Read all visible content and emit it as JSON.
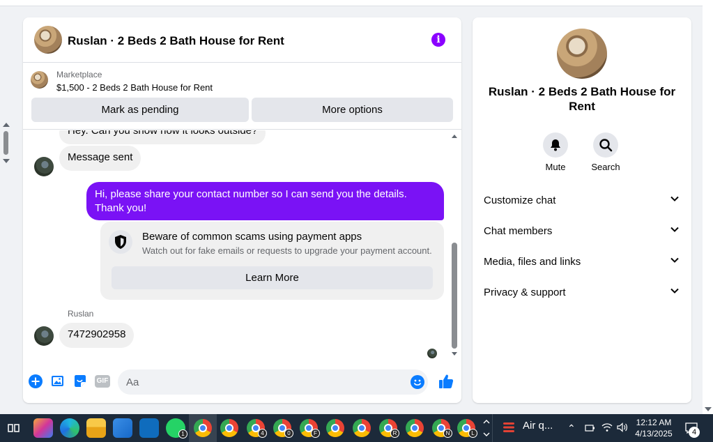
{
  "chat": {
    "title": "Ruslan · 2 Beds 2 Bath House for Rent",
    "marketplace": {
      "label": "Marketplace",
      "listing": "$1,500 - 2 Beds 2 Bath House for Rent",
      "mark_pending_label": "Mark as pending",
      "more_options_label": "More options"
    },
    "messages": {
      "partial_message": "Hey. Can you show how it looks outside?",
      "message_sent": "Message sent",
      "outgoing": "Hi, please share your contact number so I can send you the details. Thank you!",
      "scam_warning": {
        "title": "Beware of common scams using payment apps",
        "subtitle": "Watch out for fake emails or requests to upgrade your payment account.",
        "button": "Learn More"
      },
      "sender_name": "Ruslan",
      "phone_message": "7472902958"
    },
    "composer": {
      "placeholder": "Aa",
      "gif_label": "GIF"
    },
    "accent_color": "#7a12f5"
  },
  "side_panel": {
    "title": "Ruslan · 2 Beds 2 Bath House for Rent",
    "actions": [
      {
        "label": "Mute",
        "icon": "bell-icon"
      },
      {
        "label": "Search",
        "icon": "search-icon"
      }
    ],
    "sections": [
      {
        "label": "Customize chat"
      },
      {
        "label": "Chat members"
      },
      {
        "label": "Media, files and links"
      },
      {
        "label": "Privacy & support"
      }
    ]
  },
  "taskbar": {
    "weather": "Air q...",
    "time": "12:12 AM",
    "date": "4/13/2025",
    "notification_count": "4",
    "badges": [
      "1",
      "4",
      "0",
      "F",
      "R",
      "N",
      "L"
    ]
  }
}
